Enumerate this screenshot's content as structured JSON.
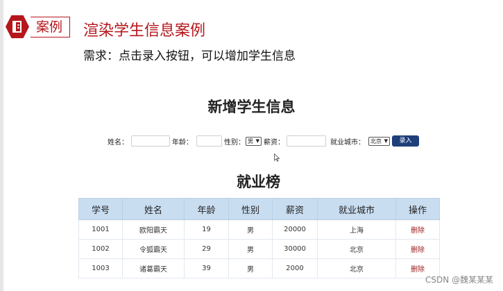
{
  "header": {
    "badge_label": "案例",
    "title": "渲染学生信息案例",
    "requirement": "需求：点击录入按钮，可以增加学生信息"
  },
  "form": {
    "title": "新增学生信息",
    "name_label": "姓名：",
    "age_label": "年龄：",
    "gender_label": "性别：",
    "gender_value": "男",
    "salary_label": "薪资：",
    "city_label": "就业城市：",
    "city_value": "北京",
    "submit_label": "录入"
  },
  "table": {
    "title": "就业榜",
    "headers": [
      "学号",
      "姓名",
      "年龄",
      "性别",
      "薪资",
      "就业城市",
      "操作"
    ],
    "rows": [
      {
        "id": "1001",
        "name": "欧阳霸天",
        "age": "19",
        "gender": "男",
        "salary": "20000",
        "city": "上海",
        "action": "删除"
      },
      {
        "id": "1002",
        "name": "令狐霸天",
        "age": "29",
        "gender": "男",
        "salary": "30000",
        "city": "北京",
        "action": "删除"
      },
      {
        "id": "1003",
        "name": "诸葛霸天",
        "age": "39",
        "gender": "男",
        "salary": "2000",
        "city": "北京",
        "action": "删除"
      }
    ]
  },
  "watermark": "CSDN @魏某某某",
  "colors": {
    "accent": "#b5161c",
    "button": "#1e3f7a",
    "table_header": "#c9ddf1",
    "delete_link": "#9b1b1b"
  }
}
